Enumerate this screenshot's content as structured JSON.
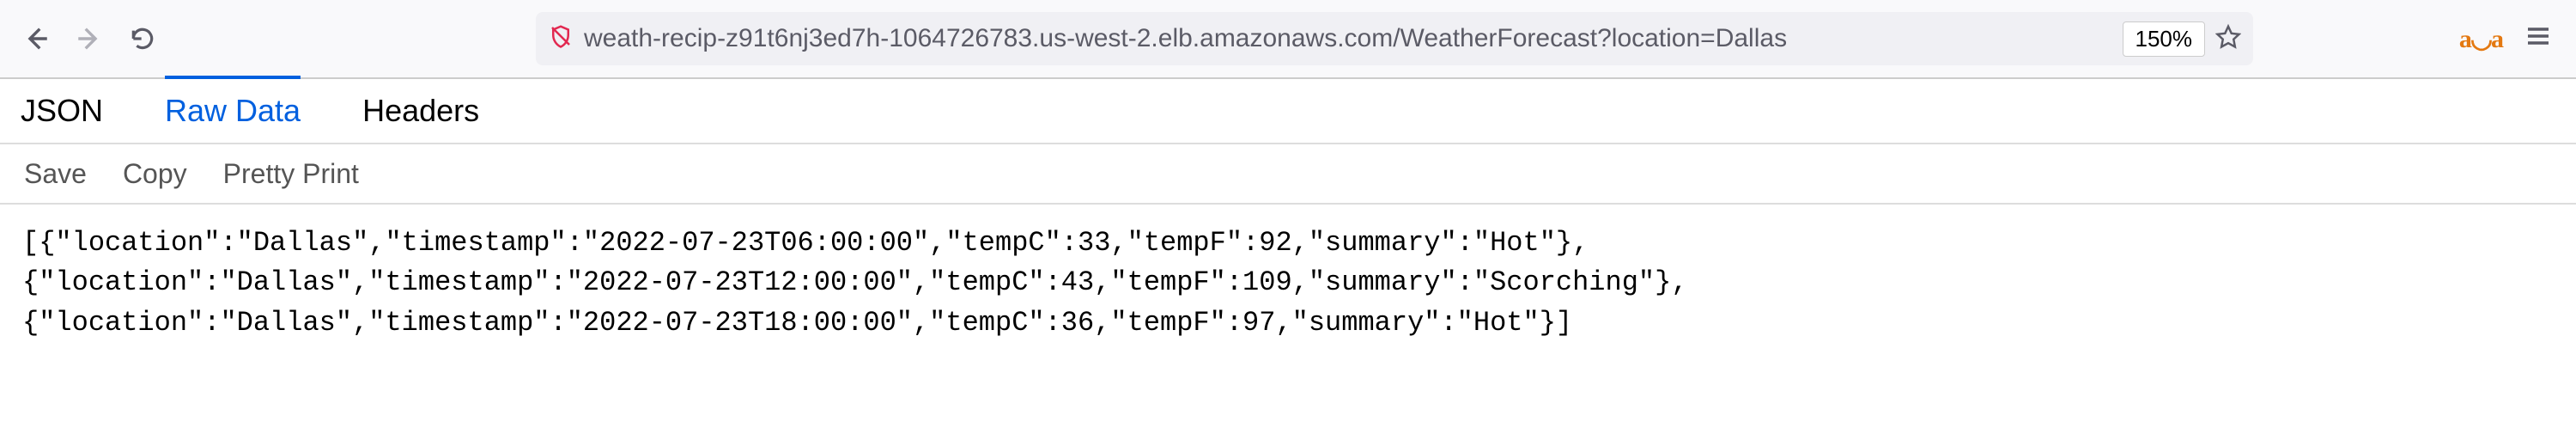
{
  "chrome": {
    "url": "weath-recip-z91t6nj3ed7h-1064726783.us-west-2.elb.amazonaws.com/WeatherForecast?location=Dallas",
    "zoom": "150%"
  },
  "viewer": {
    "tabs": {
      "json": "JSON",
      "raw": "Raw Data",
      "headers": "Headers"
    },
    "actions": {
      "save": "Save",
      "copy": "Copy",
      "pretty": "Pretty Print"
    },
    "raw_text": "[{\"location\":\"Dallas\",\"timestamp\":\"2022-07-23T06:00:00\",\"tempC\":33,\"tempF\":92,\"summary\":\"Hot\"},\n{\"location\":\"Dallas\",\"timestamp\":\"2022-07-23T12:00:00\",\"tempC\":43,\"tempF\":109,\"summary\":\"Scorching\"},\n{\"location\":\"Dallas\",\"timestamp\":\"2022-07-23T18:00:00\",\"tempC\":36,\"tempF\":97,\"summary\":\"Hot\"}]"
  }
}
